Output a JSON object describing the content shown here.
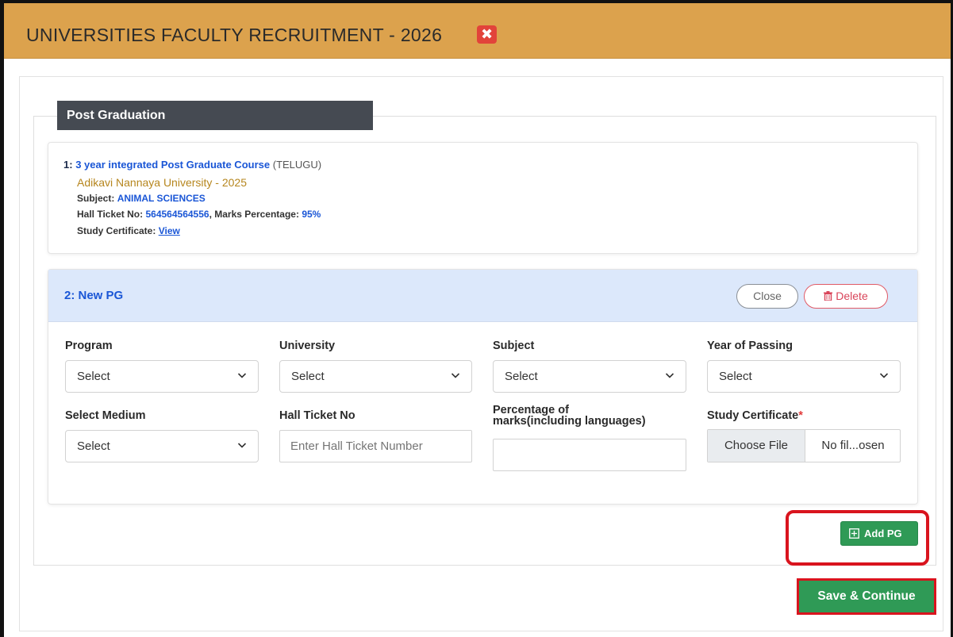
{
  "header": {
    "title": "UNIVERSITIES FACULTY RECRUITMENT - 2026",
    "close_glyph": "✖"
  },
  "section": {
    "title": "Post Graduation"
  },
  "entry1": {
    "index": "1:",
    "course": "3 year integrated Post Graduate Course",
    "medium": "(TELUGU)",
    "university_year": "Adikavi Nannaya University - 2025",
    "subject_label": "Subject:",
    "subject_value": "ANIMAL SCIENCES",
    "hall_ticket_label": "Hall Ticket No:",
    "hall_ticket_value": "564564564556",
    "marks_label": ", Marks Percentage:",
    "marks_value": "95%",
    "certificate_label": "Study Certificate:",
    "certificate_link": "View"
  },
  "entry2": {
    "title": "2: New PG",
    "close_label": "Close",
    "delete_label": "Delete",
    "fields": {
      "program": {
        "label": "Program",
        "value": "Select"
      },
      "university": {
        "label": "University",
        "value": "Select"
      },
      "subject": {
        "label": "Subject",
        "value": "Select"
      },
      "year": {
        "label": "Year of Passing",
        "value": "Select"
      },
      "medium": {
        "label": "Select Medium",
        "value": "Select"
      },
      "hall_ticket": {
        "label": "Hall Ticket No",
        "placeholder": "Enter Hall Ticket Number"
      },
      "percentage": {
        "label_line1": "Percentage of",
        "label_line2": "marks(including languages)",
        "value": ""
      },
      "certificate": {
        "label": "Study Certificate",
        "required_mark": "*",
        "button": "Choose File",
        "file_name": "No fil...osen"
      }
    }
  },
  "actions": {
    "add_pg": "Add PG",
    "save_continue": "Save & Continue"
  },
  "colors": {
    "header": "#dca24d",
    "accent_blue": "#1a56d6",
    "success": "#2f9a56",
    "danger": "#d9141e"
  }
}
